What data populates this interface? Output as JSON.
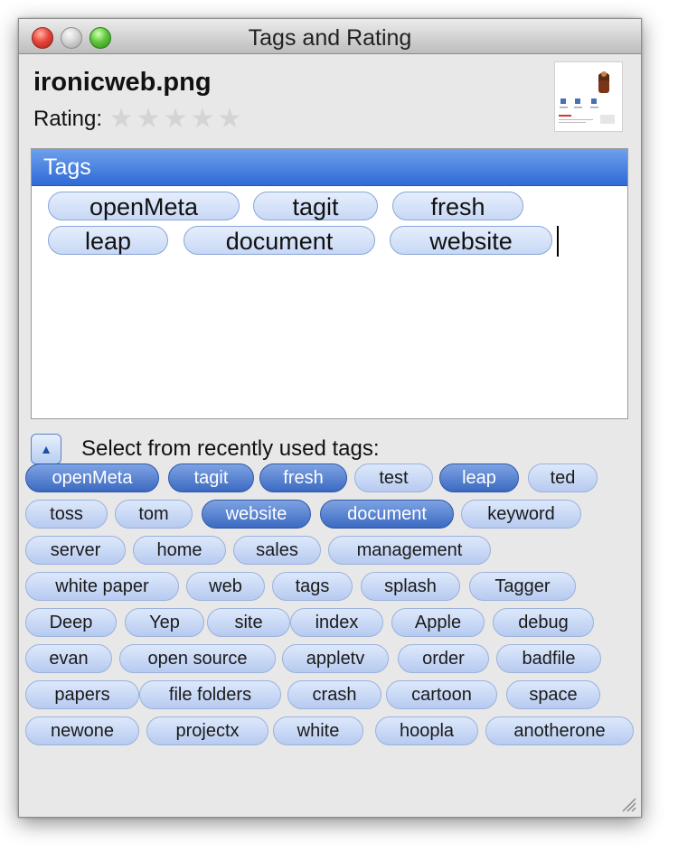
{
  "window": {
    "title": "Tags and Rating"
  },
  "file": {
    "name": "ironicweb.png",
    "rating_label": "Rating:",
    "rating": 0,
    "max_rating": 5
  },
  "tags_panel": {
    "header": "Tags",
    "tags": [
      "openMeta",
      "tagit",
      "fresh",
      "leap",
      "document",
      "website"
    ]
  },
  "recent": {
    "label": "Select from recently used tags:",
    "tags": [
      {
        "label": "openMeta",
        "selected": true
      },
      {
        "label": "tagit",
        "selected": true
      },
      {
        "label": "fresh",
        "selected": true
      },
      {
        "label": "test",
        "selected": false
      },
      {
        "label": "leap",
        "selected": true
      },
      {
        "label": "ted",
        "selected": false
      },
      {
        "label": "toss",
        "selected": false
      },
      {
        "label": "tom",
        "selected": false
      },
      {
        "label": "website",
        "selected": true
      },
      {
        "label": "document",
        "selected": true
      },
      {
        "label": "keyword",
        "selected": false
      },
      {
        "label": "server",
        "selected": false
      },
      {
        "label": "home",
        "selected": false
      },
      {
        "label": "sales",
        "selected": false
      },
      {
        "label": "management",
        "selected": false
      },
      {
        "label": "white paper",
        "selected": false
      },
      {
        "label": "web",
        "selected": false
      },
      {
        "label": "tags",
        "selected": false
      },
      {
        "label": "splash",
        "selected": false
      },
      {
        "label": "Tagger",
        "selected": false
      },
      {
        "label": "Deep",
        "selected": false
      },
      {
        "label": "Yep",
        "selected": false
      },
      {
        "label": "site",
        "selected": false
      },
      {
        "label": "index",
        "selected": false
      },
      {
        "label": "Apple",
        "selected": false
      },
      {
        "label": "debug",
        "selected": false
      },
      {
        "label": "evan",
        "selected": false
      },
      {
        "label": "open source",
        "selected": false
      },
      {
        "label": "appletv",
        "selected": false
      },
      {
        "label": "order",
        "selected": false
      },
      {
        "label": "badfile",
        "selected": false
      },
      {
        "label": "papers",
        "selected": false
      },
      {
        "label": "file folders",
        "selected": false
      },
      {
        "label": "crash",
        "selected": false
      },
      {
        "label": "cartoon",
        "selected": false
      },
      {
        "label": "space",
        "selected": false
      },
      {
        "label": "newone",
        "selected": false
      },
      {
        "label": "projectx",
        "selected": false
      },
      {
        "label": "white",
        "selected": false
      },
      {
        "label": "hoopla",
        "selected": false
      },
      {
        "label": "anotherone",
        "selected": false
      }
    ]
  },
  "colors": {
    "accent": "#3c6ac2",
    "header_blue": "#2f6ad6"
  }
}
